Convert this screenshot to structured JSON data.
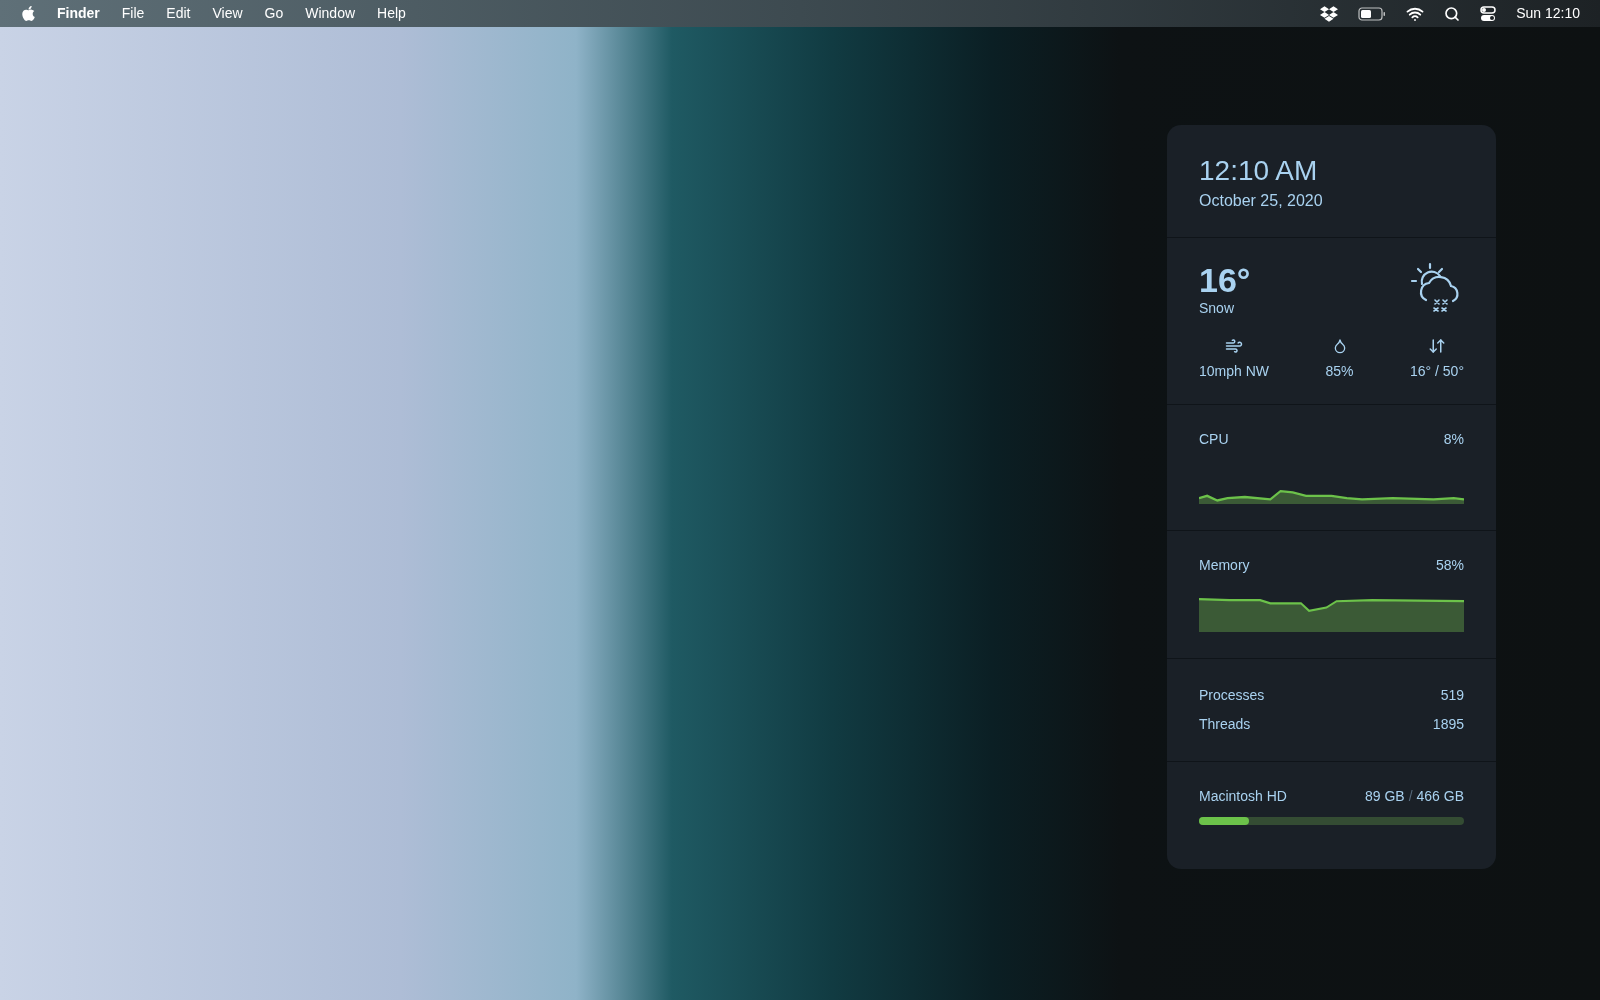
{
  "menu_bar": {
    "items": [
      {
        "label": "Finder",
        "kind": "app"
      },
      {
        "label": "File",
        "kind": "menu"
      },
      {
        "label": "Edit",
        "kind": "menu"
      },
      {
        "label": "View",
        "kind": "menu"
      },
      {
        "label": "Go",
        "kind": "menu"
      },
      {
        "label": "Window",
        "kind": "menu"
      },
      {
        "label": "Help",
        "kind": "menu"
      }
    ],
    "clock": "Sun 12:10"
  },
  "widget": {
    "time": "12:10 AM",
    "date": "October 25, 2020",
    "weather": {
      "temperature": "16°",
      "condition": "Snow",
      "wind": "10mph NW",
      "humidity": "85%",
      "range": "16° / 50°"
    },
    "cpu": {
      "label": "CPU",
      "value": "8%"
    },
    "memory": {
      "label": "Memory",
      "value": "58%"
    },
    "stats": [
      {
        "label": "Processes",
        "value": "519"
      },
      {
        "label": "Threads",
        "value": "1895"
      }
    ],
    "disk": {
      "name": "Macintosh HD",
      "used": "89 GB",
      "separator": "/",
      "total": "466 GB",
      "level": 0.19
    }
  }
}
